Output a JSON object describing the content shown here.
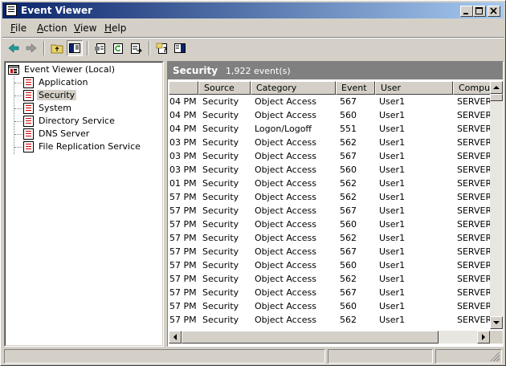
{
  "window": {
    "title": "Event Viewer"
  },
  "menu": [
    {
      "label": "File",
      "key": "F",
      "rest": "ile"
    },
    {
      "label": "Action",
      "key": "A",
      "rest": "ction"
    },
    {
      "label": "View",
      "key": "V",
      "rest": "iew"
    },
    {
      "label": "Help",
      "key": "H",
      "rest": "elp"
    }
  ],
  "toolbar": {
    "icons": [
      "back-arrow-icon",
      "forward-arrow-icon",
      "up-one-level-icon",
      "show-hide-console-tree-icon",
      "properties-icon",
      "refresh-icon",
      "export-list-icon",
      "help-icon",
      "show-hide-action-pane-icon"
    ]
  },
  "tree": {
    "root": "Event Viewer (Local)",
    "items": [
      "Application",
      "Security",
      "System",
      "Directory Service",
      "DNS Server",
      "File Replication Service"
    ],
    "selected": "Security"
  },
  "pane": {
    "title": "Security",
    "count": "1,922 event(s)"
  },
  "columns": [
    "",
    "Source",
    "Category",
    "Event",
    "User",
    "Computer"
  ],
  "rows": [
    [
      "04 PM",
      "Security",
      "Object Access",
      "567",
      "User1",
      "SERVER"
    ],
    [
      "04 PM",
      "Security",
      "Object Access",
      "560",
      "User1",
      "SERVER"
    ],
    [
      "04 PM",
      "Security",
      "Logon/Logoff",
      "551",
      "User1",
      "SERVER"
    ],
    [
      "03 PM",
      "Security",
      "Object Access",
      "562",
      "User1",
      "SERVER"
    ],
    [
      "03 PM",
      "Security",
      "Object Access",
      "567",
      "User1",
      "SERVER"
    ],
    [
      "03 PM",
      "Security",
      "Object Access",
      "560",
      "User1",
      "SERVER"
    ],
    [
      "01 PM",
      "Security",
      "Object Access",
      "562",
      "User1",
      "SERVER"
    ],
    [
      "57 PM",
      "Security",
      "Object Access",
      "562",
      "User1",
      "SERVER"
    ],
    [
      "57 PM",
      "Security",
      "Object Access",
      "567",
      "User1",
      "SERVER"
    ],
    [
      "57 PM",
      "Security",
      "Object Access",
      "560",
      "User1",
      "SERVER"
    ],
    [
      "57 PM",
      "Security",
      "Object Access",
      "562",
      "User1",
      "SERVER"
    ],
    [
      "57 PM",
      "Security",
      "Object Access",
      "567",
      "User1",
      "SERVER"
    ],
    [
      "57 PM",
      "Security",
      "Object Access",
      "560",
      "User1",
      "SERVER"
    ],
    [
      "57 PM",
      "Security",
      "Object Access",
      "562",
      "User1",
      "SERVER"
    ],
    [
      "57 PM",
      "Security",
      "Object Access",
      "567",
      "User1",
      "SERVER"
    ],
    [
      "57 PM",
      "Security",
      "Object Access",
      "560",
      "User1",
      "SERVER"
    ],
    [
      "57 PM",
      "Security",
      "Object Access",
      "562",
      "User1",
      "SERVER"
    ],
    [
      "57 PM",
      "Security",
      "Object Access",
      "567",
      "User1",
      "SERVER"
    ]
  ],
  "colors": {
    "titlebar_start": "#0a246a",
    "titlebar_end": "#a6caf0",
    "face": "#d4d0c8",
    "pane_header": "#808080"
  }
}
